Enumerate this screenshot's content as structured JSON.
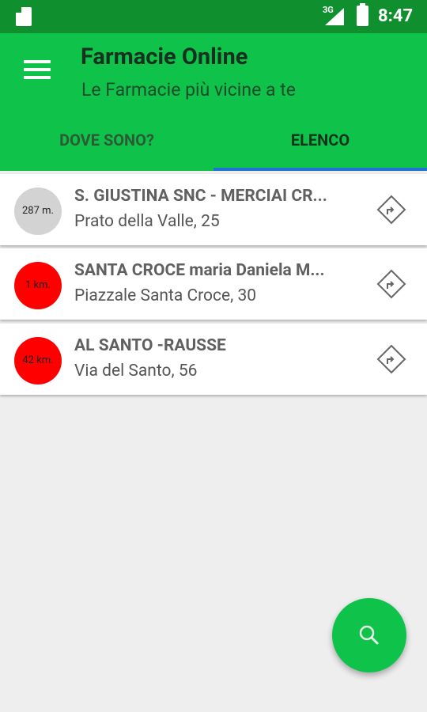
{
  "status_bar": {
    "network": "3G",
    "time": "8:47",
    "icons": [
      "sd-card-icon",
      "signal-icon",
      "battery-icon"
    ]
  },
  "app_bar": {
    "title": "Farmacie Online",
    "subtitle": "Le Farmacie più vicine a te",
    "menu_icon": "hamburger-menu-icon"
  },
  "tabs": [
    {
      "label": "DOVE SONO?",
      "selected": false
    },
    {
      "label": "ELENCO",
      "selected": true
    }
  ],
  "pharmacies": [
    {
      "distance": "287 m.",
      "name": "S. GIUSTINA SNC - MERCIAI CR...",
      "address": "Prato della Valle, 25",
      "distance_color": "#d3d3d3"
    },
    {
      "distance": "1 km.",
      "name": "SANTA CROCE maria Daniela M...",
      "address": "Piazzale Santa Croce, 30",
      "distance_color": "#ff0000"
    },
    {
      "distance": "42 km.",
      "name": "AL SANTO -RAUSSE",
      "address": "Via del Santo, 56",
      "distance_color": "#ff0000"
    }
  ],
  "fab": {
    "icon": "search-icon"
  },
  "colors": {
    "app_bar": "#0ec24a",
    "status_bar": "#0f8f2e",
    "tab_indicator": "#1e73d4",
    "background": "#eeeeee"
  }
}
